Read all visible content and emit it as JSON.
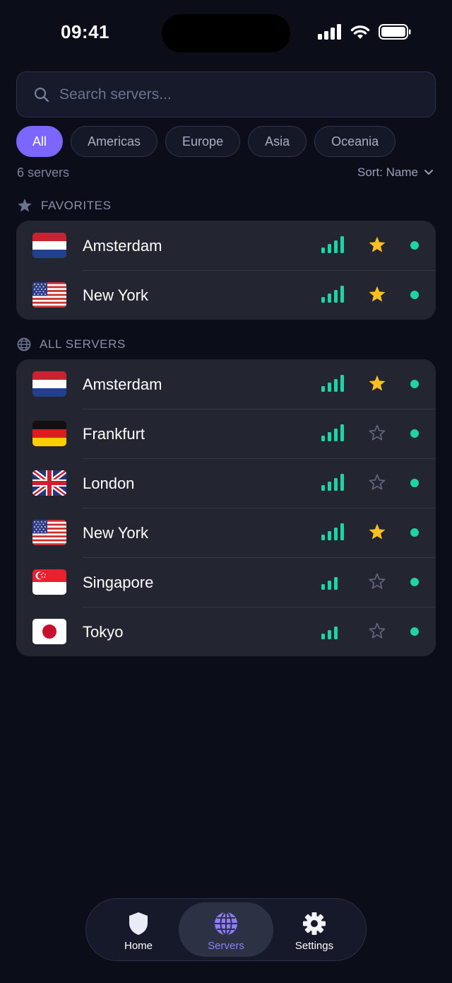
{
  "status": {
    "time": "09:41"
  },
  "search": {
    "placeholder": "Search servers..."
  },
  "filters": [
    "All",
    "Americas",
    "Europe",
    "Asia",
    "Oceania"
  ],
  "meta": {
    "count": "6 servers",
    "sort": "Sort: Name"
  },
  "favorites": {
    "title": "FAVORITES",
    "items": [
      {
        "city": "Amsterdam",
        "flag": "netherlands",
        "signal": 4,
        "favorite": true,
        "online": true
      },
      {
        "city": "New York",
        "flag": "usa",
        "signal": 4,
        "favorite": true,
        "online": true
      }
    ]
  },
  "all_servers": {
    "title": "ALL SERVERS",
    "items": [
      {
        "city": "Amsterdam",
        "flag": "netherlands",
        "signal": 4,
        "favorite": true,
        "online": true
      },
      {
        "city": "Frankfurt",
        "flag": "germany",
        "signal": 4,
        "favorite": false,
        "online": true
      },
      {
        "city": "London",
        "flag": "uk",
        "signal": 4,
        "favorite": false,
        "online": true
      },
      {
        "city": "New York",
        "flag": "usa",
        "signal": 4,
        "favorite": true,
        "online": true
      },
      {
        "city": "Singapore",
        "flag": "singapore",
        "signal": 3,
        "favorite": false,
        "online": true
      },
      {
        "city": "Tokyo",
        "flag": "japan",
        "signal": 3,
        "favorite": false,
        "online": true
      }
    ]
  },
  "tabs": [
    {
      "label": "Home",
      "icon": "shield-icon",
      "active": false
    },
    {
      "label": "Servers",
      "icon": "globe-icon",
      "active": true
    },
    {
      "label": "Settings",
      "icon": "gear-icon",
      "active": false
    }
  ],
  "colors": {
    "accent": "#7b66ff",
    "signal": "#1ed3a4",
    "favorite_star": "#ffbf1f",
    "online_dot": "#1ed3a4"
  }
}
